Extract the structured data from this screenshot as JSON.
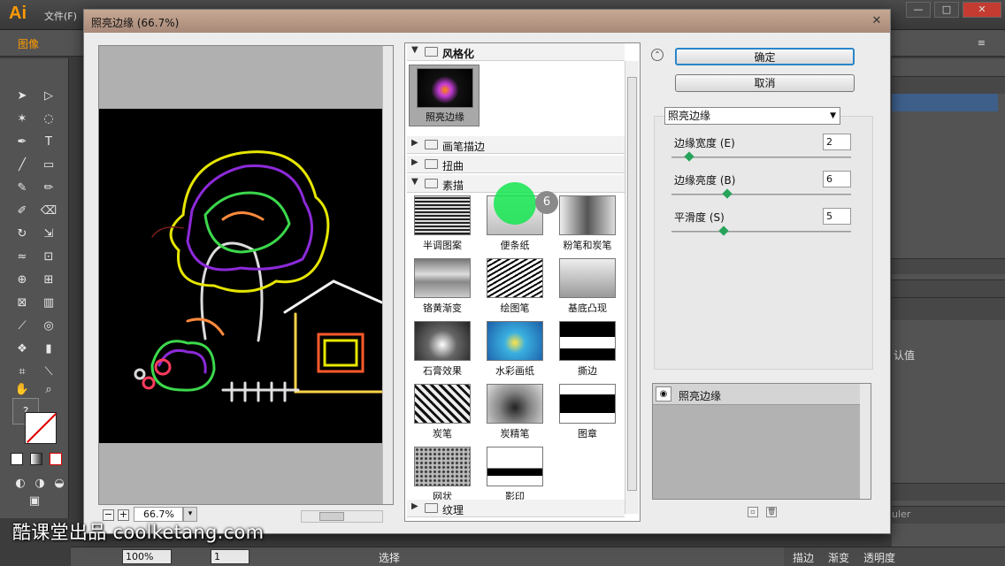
{
  "app": {
    "logo": "Ai",
    "menu_file": "文件(F)",
    "control_label": "图像",
    "control_menu_icon": "≡",
    "window_buttons": [
      "—",
      "□",
      "✕"
    ]
  },
  "tools": {
    "help": "?"
  },
  "dock": {
    "default_value": "认值",
    "ruler_label": "uler"
  },
  "status": {
    "zoom": "100%",
    "artboard": "1",
    "tool_name": "选择"
  },
  "bottom_tabs": [
    "描边",
    "渐变",
    "透明度"
  ],
  "watermark": "酷课堂出品 coolketang.com",
  "dialog": {
    "title": "照亮边缘 (66.7%)",
    "close": "✕",
    "zoom_value": "66.7%",
    "zoom_out": "−",
    "zoom_in": "+",
    "zoom_dropdown": "▾",
    "collapse": "⌃",
    "ok_label": "确定",
    "cancel_label": "取消",
    "filter_selected": "照亮边缘",
    "filter_arrow": "▼",
    "params": [
      {
        "label": "边缘宽度 (E)",
        "value": "2",
        "level": 0.08
      },
      {
        "label": "边缘亮度 (B)",
        "value": "6",
        "level": 0.3
      },
      {
        "label": "平滑度 (S)",
        "value": "5",
        "level": 0.28
      }
    ],
    "layer_name": "照亮边缘",
    "eye_icon": "◉",
    "new_layer_icon": "▫",
    "delete_layer_icon": "🗑"
  },
  "gallery": {
    "categories": [
      {
        "label": "风格化",
        "expanded": true
      },
      {
        "label": "画笔描边",
        "expanded": false
      },
      {
        "label": "扭曲",
        "expanded": false
      },
      {
        "label": "素描",
        "expanded": true
      },
      {
        "label": "纹理",
        "expanded": false
      }
    ],
    "stylize_item": "照亮边缘",
    "sketch_items": [
      "半调图案",
      "便条纸",
      "粉笔和炭笔",
      "铬黄渐变",
      "绘图笔",
      "基底凸现",
      "石膏效果",
      "水彩画纸",
      "撕边",
      "炭笔",
      "炭精笔",
      "图章",
      "网状",
      "影印"
    ]
  },
  "cursor": {
    "badge": "6"
  }
}
